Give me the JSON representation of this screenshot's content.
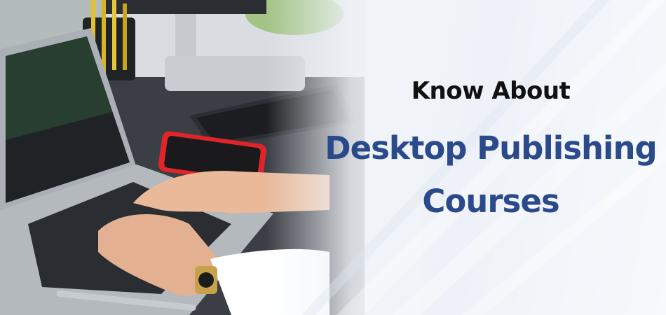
{
  "banner": {
    "kicker": "Know About",
    "title_line1": "Desktop Publishing",
    "title_line2": "Courses"
  },
  "colors": {
    "title": "#2b4a8b",
    "kicker": "#111111",
    "background": "#eef2f7",
    "phone": "#e0242a"
  },
  "illustration": {
    "description_icons": [
      "laptop-icon",
      "keyboard-icon",
      "monitor-icon",
      "phone-icon",
      "pencil-cup-icon",
      "wristwatch-icon",
      "pen-icon"
    ]
  }
}
